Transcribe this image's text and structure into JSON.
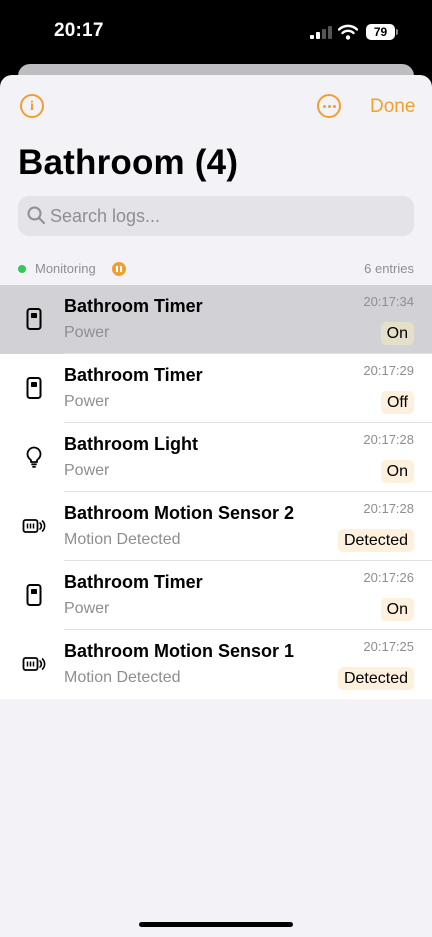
{
  "status_bar": {
    "time": "20:17",
    "battery": "79"
  },
  "header": {
    "done_label": "Done"
  },
  "page": {
    "title": "Bathroom (4)"
  },
  "search": {
    "placeholder": "Search logs..."
  },
  "monitor": {
    "label": "Monitoring",
    "entries": "6 entries"
  },
  "colors": {
    "accent": "#f0a030",
    "monitoring": "#34c759",
    "badge_bg": "#fdf1dd",
    "selected_row": "#d1d1d6"
  },
  "logs": [
    {
      "name": "Bathroom Timer",
      "characteristic": "Power",
      "time": "20:17:34",
      "value": "On",
      "icon": "timer-switch-icon",
      "selected": true
    },
    {
      "name": "Bathroom Timer",
      "characteristic": "Power",
      "time": "20:17:29",
      "value": "Off",
      "icon": "timer-switch-icon",
      "selected": false
    },
    {
      "name": "Bathroom Light",
      "characteristic": "Power",
      "time": "20:17:28",
      "value": "On",
      "icon": "lightbulb-icon",
      "selected": false
    },
    {
      "name": "Bathroom Motion Sensor 2",
      "characteristic": "Motion Detected",
      "time": "20:17:28",
      "value": "Detected",
      "icon": "motion-sensor-icon",
      "selected": false
    },
    {
      "name": "Bathroom Timer",
      "characteristic": "Power",
      "time": "20:17:26",
      "value": "On",
      "icon": "timer-switch-icon",
      "selected": false
    },
    {
      "name": "Bathroom Motion Sensor 1",
      "characteristic": "Motion Detected",
      "time": "20:17:25",
      "value": "Detected",
      "icon": "motion-sensor-icon",
      "selected": false
    }
  ]
}
